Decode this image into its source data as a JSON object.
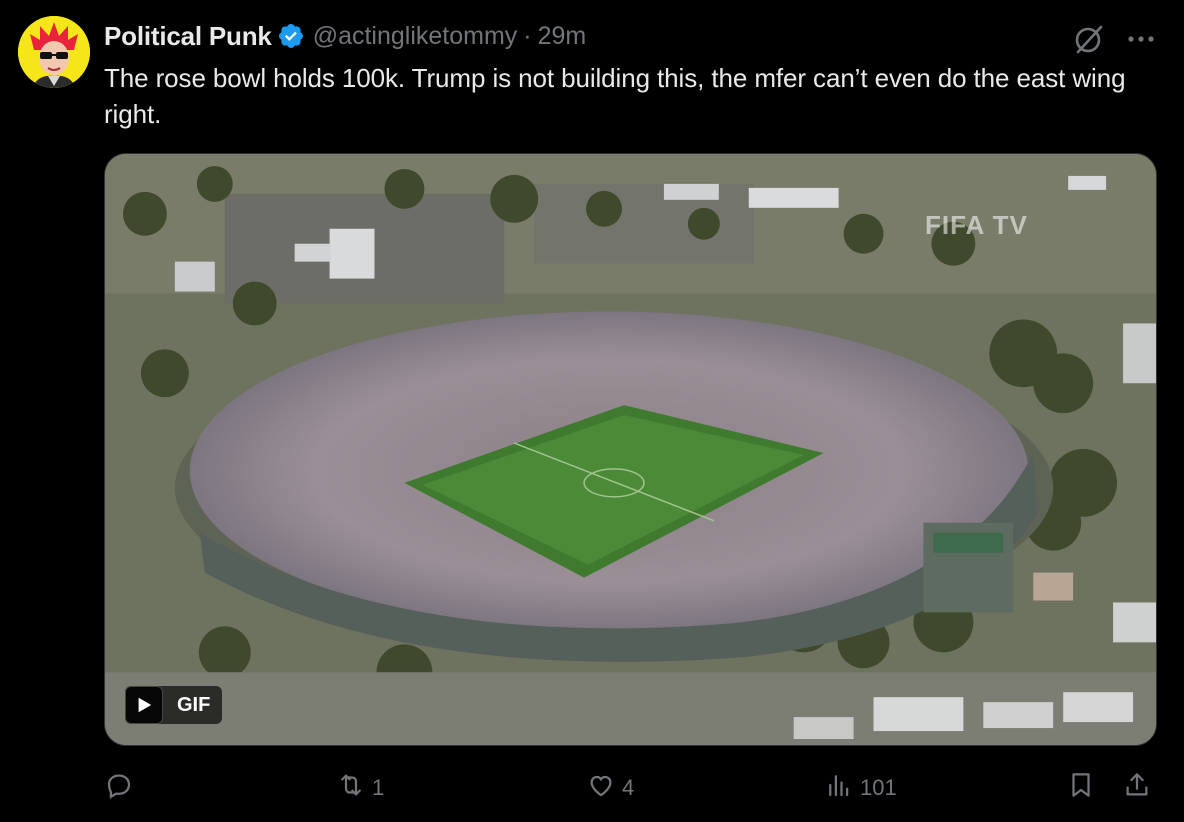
{
  "tweet": {
    "display_name": "Political Punk",
    "handle": "@actingliketommy",
    "separator": "·",
    "time": "29m",
    "text": "The rose bowl holds 100k. Trump is not building this, the mfer can’t even do the east wing right.",
    "verified": true
  },
  "media": {
    "type": "gif",
    "badge_label": "GIF",
    "watermark": "FIFA TV"
  },
  "actions": {
    "reply_count": "",
    "retweet_count": "1",
    "like_count": "4",
    "views_count": "101"
  },
  "icons": {
    "avatar": "avatar-image",
    "verified": "verified-badge-icon",
    "grok": "grok-icon",
    "more": "more-icon",
    "play": "play-icon",
    "reply": "reply-icon",
    "retweet": "retweet-icon",
    "like": "like-icon",
    "views": "views-icon",
    "bookmark": "bookmark-icon",
    "share": "share-icon"
  },
  "colors": {
    "background": "#000000",
    "text_primary": "#e7e9ea",
    "text_secondary": "#71767b",
    "verified_blue": "#1d9bf0",
    "avatar_bg": "#f6e619"
  }
}
